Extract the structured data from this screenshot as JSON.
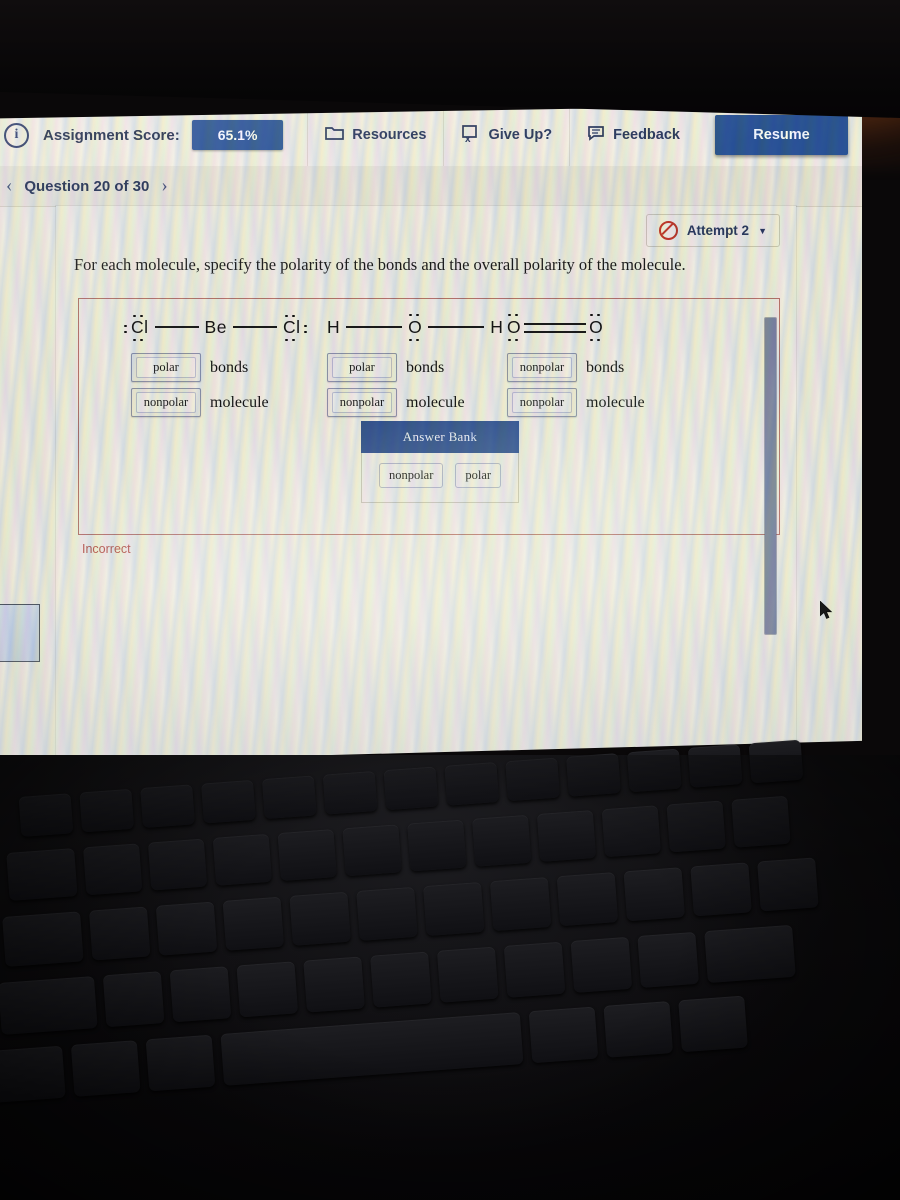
{
  "header": {
    "info_icon": "info-icon",
    "score_label": "Assignment Score:",
    "score_value": "65.1%",
    "tools": [
      {
        "label": "Resources",
        "icon": "folder-icon"
      },
      {
        "label": "Give Up?",
        "icon": "give-up-icon"
      },
      {
        "label": "Feedback",
        "icon": "comment-icon"
      }
    ],
    "resume_label": "Resume"
  },
  "question_bar": {
    "prev_icon": "chevron-left-icon",
    "title": "Question 20 of 30",
    "next_icon": "chevron-right-icon"
  },
  "attempt": {
    "icon": "no-entry-icon",
    "label": "Attempt 2",
    "caret": "▼"
  },
  "prompt": "For each molecule, specify the polarity of the bonds and the overall polarity of the molecule.",
  "molecules": [
    {
      "name": "beryllium-chloride",
      "atoms": [
        "Cl",
        "Be",
        "Cl"
      ],
      "bond_type": "single",
      "bonds_answer": "polar",
      "bonds_label": "bonds",
      "molecule_answer": "nonpolar",
      "molecule_label": "molecule"
    },
    {
      "name": "water",
      "atoms": [
        "H",
        "O",
        "H"
      ],
      "bond_type": "single",
      "bonds_answer": "polar",
      "bonds_label": "bonds",
      "molecule_answer": "nonpolar",
      "molecule_label": "molecule"
    },
    {
      "name": "oxygen",
      "atoms": [
        "O",
        "O"
      ],
      "bond_type": "double",
      "bonds_answer": "nonpolar",
      "bonds_label": "bonds",
      "molecule_answer": "nonpolar",
      "molecule_label": "molecule"
    }
  ],
  "answer_bank": {
    "title": "Answer Bank",
    "options": [
      "nonpolar",
      "polar"
    ]
  },
  "status": {
    "incorrect_label": "Incorrect"
  },
  "colors": {
    "brand_blue": "#2c5697",
    "bank_header": "#33538f",
    "incorrect_red": "#b6564c",
    "screen_bg": "#eceadf"
  }
}
